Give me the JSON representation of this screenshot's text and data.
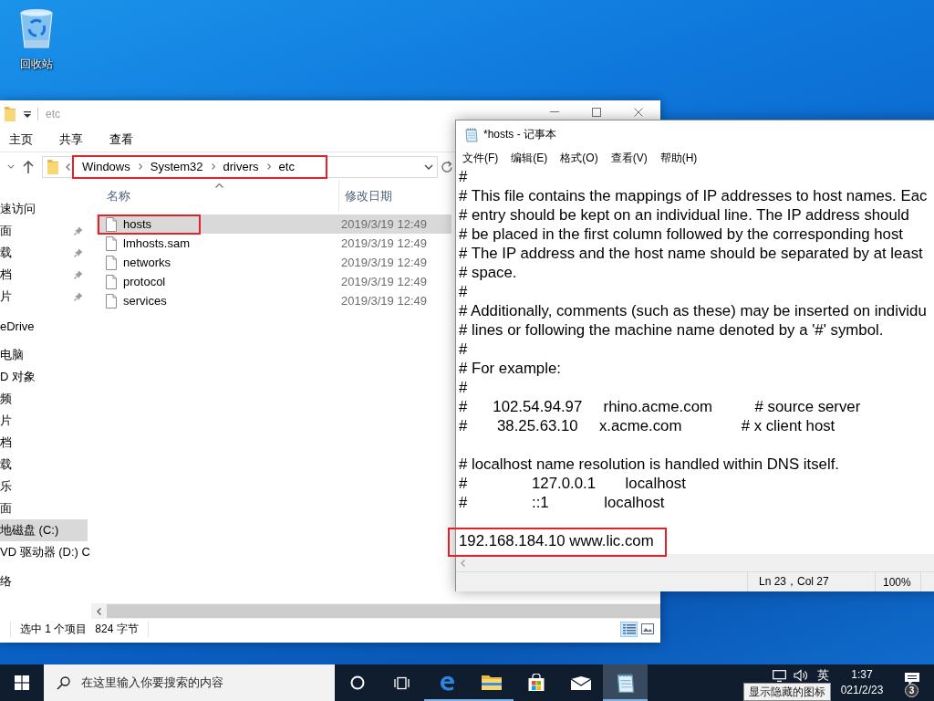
{
  "desktop": {
    "icons": [
      {
        "label": "回收站"
      }
    ]
  },
  "explorer": {
    "title": "etc",
    "ribbon_tabs": [
      {
        "label": "主页"
      },
      {
        "label": "共享"
      },
      {
        "label": "查看"
      }
    ],
    "breadcrumb": {
      "items": [
        "Windows",
        "System32",
        "drivers",
        "etc"
      ],
      "outlined": true
    },
    "sidebar": [
      {
        "label": "速访问",
        "selected": false,
        "pinned": false,
        "children": [
          {
            "label": "面",
            "selected": false,
            "pinned": true
          },
          {
            "label": "载",
            "selected": false,
            "pinned": true
          },
          {
            "label": "档",
            "selected": false,
            "pinned": true
          },
          {
            "label": "片",
            "selected": false,
            "pinned": true
          }
        ]
      },
      {
        "label": "eDrive",
        "selected": false,
        "pinned": false
      },
      {
        "label": "电脑",
        "selected": false,
        "pinned": false,
        "children": [
          {
            "label": "D 对象",
            "selected": false,
            "pinned": false
          },
          {
            "label": "频",
            "selected": false,
            "pinned": false
          },
          {
            "label": "片",
            "selected": false,
            "pinned": false
          },
          {
            "label": "档",
            "selected": false,
            "pinned": false
          },
          {
            "label": "载",
            "selected": false,
            "pinned": false
          },
          {
            "label": "乐",
            "selected": false,
            "pinned": false
          },
          {
            "label": "面",
            "selected": false,
            "pinned": false
          },
          {
            "label": "地磁盘 (C:)",
            "selected": true,
            "pinned": false
          },
          {
            "label": "VD 驱动器 (D:) C",
            "selected": false,
            "pinned": false
          }
        ]
      },
      {
        "label": "络",
        "selected": false,
        "pinned": false
      }
    ],
    "columns": [
      {
        "label": "名称",
        "sorted": true
      },
      {
        "label": "修改日期",
        "sorted": false
      }
    ],
    "files": [
      {
        "name": "hosts",
        "modified": "2019/3/19 12:49",
        "selected": true,
        "outlined": true
      },
      {
        "name": "lmhosts.sam",
        "modified": "2019/3/19 12:49",
        "selected": false,
        "outlined": false
      },
      {
        "name": "networks",
        "modified": "2019/3/19 12:49",
        "selected": false,
        "outlined": false
      },
      {
        "name": "protocol",
        "modified": "2019/3/19 12:49",
        "selected": false,
        "outlined": false
      },
      {
        "name": "services",
        "modified": "2019/3/19 12:49",
        "selected": false,
        "outlined": false
      }
    ],
    "status": {
      "selection": "选中 1 个项目",
      "size": "824 字节",
      "view_modes": [
        {
          "kind": "details",
          "selected": true
        },
        {
          "kind": "large-icons",
          "selected": false
        }
      ]
    }
  },
  "notepad": {
    "title": "*hosts - 记事本",
    "menu": [
      "文件(F)",
      "编辑(E)",
      "格式(O)",
      "查看(V)",
      "帮助(H)"
    ],
    "lines": [
      {
        "kind": "text",
        "text": "#",
        "outlined": false
      },
      {
        "kind": "text",
        "text": "# This file contains the mappings of IP addresses to host names. Eac",
        "outlined": false
      },
      {
        "kind": "text",
        "text": "# entry should be kept on an individual line. The IP address should",
        "outlined": false
      },
      {
        "kind": "text",
        "text": "# be placed in the first column followed by the corresponding host",
        "outlined": false
      },
      {
        "kind": "text",
        "text": "# The IP address and the host name should be separated by at least",
        "outlined": false
      },
      {
        "kind": "text",
        "text": "# space.",
        "outlined": false
      },
      {
        "kind": "text",
        "text": "#",
        "outlined": false
      },
      {
        "kind": "text",
        "text": "# Additionally, comments (such as these) may be inserted on individu",
        "outlined": false
      },
      {
        "kind": "text",
        "text": "# lines or following the machine name denoted by a '#' symbol.",
        "outlined": false
      },
      {
        "kind": "text",
        "text": "#",
        "outlined": false
      },
      {
        "kind": "text",
        "text": "# For example:",
        "outlined": false
      },
      {
        "kind": "text",
        "text": "#",
        "outlined": false
      },
      {
        "kind": "text",
        "text": "#      102.54.94.97     rhino.acme.com          # source server",
        "outlined": false
      },
      {
        "kind": "text",
        "text": "#       38.25.63.10     x.acme.com              # x client host",
        "outlined": false
      },
      {
        "kind": "blank",
        "outlined": false
      },
      {
        "kind": "text",
        "text": "# localhost name resolution is handled within DNS itself.",
        "outlined": false
      },
      {
        "kind": "text",
        "text": "#\t127.0.0.1       localhost",
        "outlined": false
      },
      {
        "kind": "text",
        "text": "#\t::1             localhost",
        "outlined": false
      },
      {
        "kind": "blank",
        "outlined": false
      },
      {
        "kind": "text",
        "text": "192.168.184.10 www.lic.com",
        "outlined": true
      }
    ],
    "status": {
      "position": "Ln 23，Col 27",
      "zoom": "100%"
    }
  },
  "taskbar": {
    "search": {
      "placeholder": "在这里输入你要搜索的内容"
    },
    "apps": [
      {
        "kind": "cortana",
        "running": false,
        "active": false
      },
      {
        "kind": "task-view",
        "running": false,
        "active": false
      },
      {
        "kind": "edge",
        "running": true,
        "active": false
      },
      {
        "kind": "explorer",
        "running": true,
        "active": false
      },
      {
        "kind": "store",
        "running": false,
        "active": false
      },
      {
        "kind": "mail",
        "running": false,
        "active": false
      },
      {
        "kind": "notepad",
        "running": true,
        "active": true
      }
    ],
    "tray": {
      "ime": "英",
      "time": "1:37",
      "date": "021/2/23",
      "notification_count": "3",
      "tooltip": "显示隐藏的图标"
    }
  }
}
